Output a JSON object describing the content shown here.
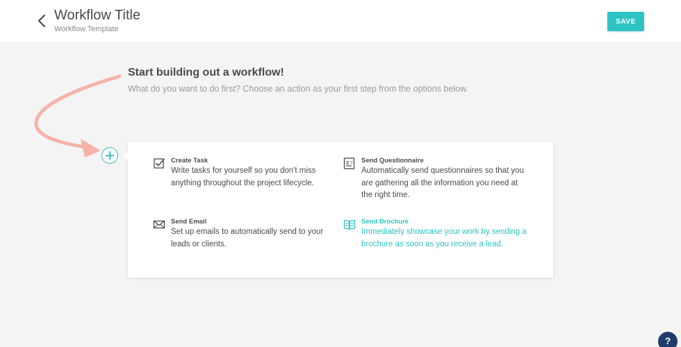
{
  "header": {
    "title": "Workflow Title",
    "subtitle": "Workflow Template",
    "save_label": "SAVE"
  },
  "intro": {
    "headline": "Start building out a workflow!",
    "subline": "What do you want to do first? Choose an action as your first step from the options below."
  },
  "options": [
    {
      "icon": "checkbox-icon",
      "title": "Create Task",
      "description": "Write tasks for yourself so you don't miss anything throughout the project lifecycle."
    },
    {
      "icon": "questionnaire-icon",
      "title": "Send Questionnaire",
      "description": "Automatically send questionnaires so that you are gathering all the information you need at the right time."
    },
    {
      "icon": "envelope-icon",
      "title": "Send Email",
      "description": "Set up emails to automatically send to your leads or clients."
    },
    {
      "icon": "brochure-icon",
      "title": "Send Brochure",
      "description": "Immediately showcase your work by sending a brochure as soon as you receive a lead.",
      "highlighted": true
    }
  ],
  "help": {
    "label": "?"
  },
  "colors": {
    "accent": "#2ec4c4",
    "arrow": "#f6b3a8",
    "help": "#1f3a6b",
    "background": "#f4f4f5"
  }
}
